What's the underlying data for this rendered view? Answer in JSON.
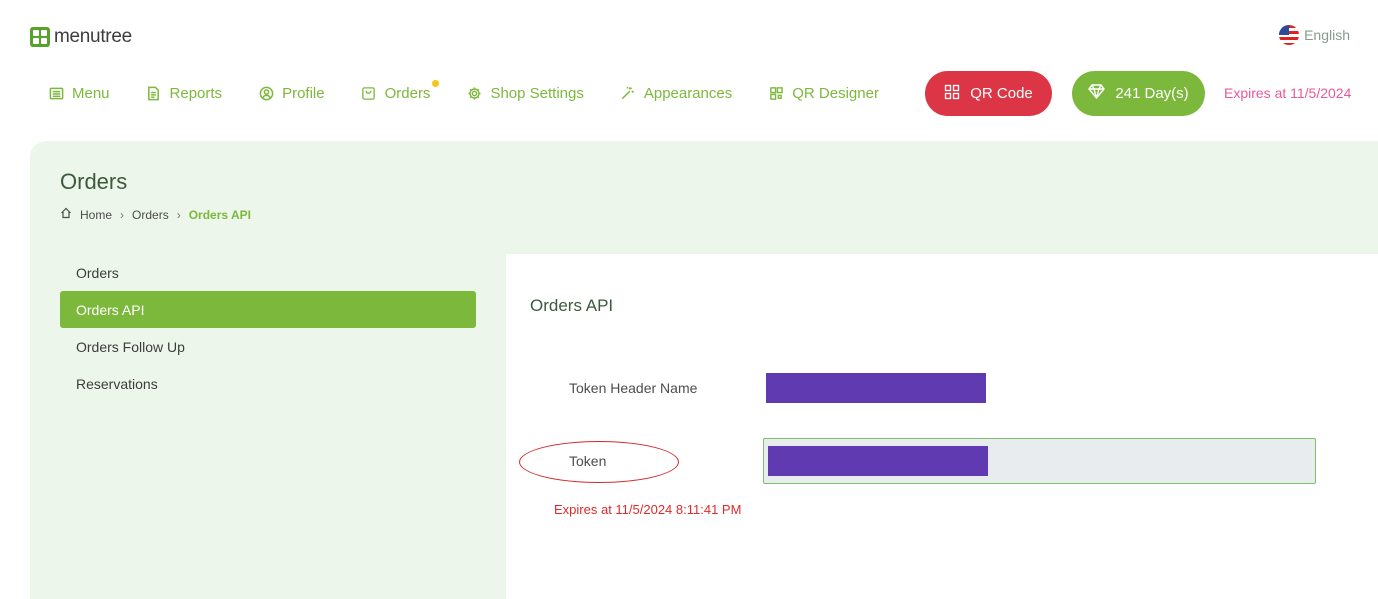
{
  "brand": {
    "name": "menutree"
  },
  "language": {
    "label": "English"
  },
  "nav": {
    "items": [
      {
        "label": "Menu",
        "icon": "menu-icon"
      },
      {
        "label": "Reports",
        "icon": "document-icon"
      },
      {
        "label": "Profile",
        "icon": "user-icon"
      },
      {
        "label": "Orders",
        "icon": "bag-icon"
      },
      {
        "label": "Shop Settings",
        "icon": "gear-icon"
      },
      {
        "label": "Appearances",
        "icon": "wand-icon"
      },
      {
        "label": "QR Designer",
        "icon": "qr-icon"
      }
    ],
    "qr_button": "QR Code",
    "days_button": "241 Day(s)",
    "expires": "Expires at 11/5/2024"
  },
  "page": {
    "title": "Orders",
    "breadcrumb": [
      "Home",
      "Orders",
      "Orders API"
    ]
  },
  "sidebar": {
    "items": [
      {
        "label": "Orders",
        "active": false
      },
      {
        "label": "Orders API",
        "active": true
      },
      {
        "label": "Orders Follow Up",
        "active": false
      },
      {
        "label": "Reservations",
        "active": false
      }
    ]
  },
  "content": {
    "title": "Orders API",
    "token_header_label": "Token Header Name",
    "token_label": "Token",
    "token_expires": "Expires at 11/5/2024 8:11:41 PM"
  },
  "colors": {
    "accent": "#7cb83c",
    "danger": "#dc3545",
    "redaction": "#5f3ab0",
    "panel": "#ecf6ea",
    "expires_pink": "#e8599a"
  }
}
